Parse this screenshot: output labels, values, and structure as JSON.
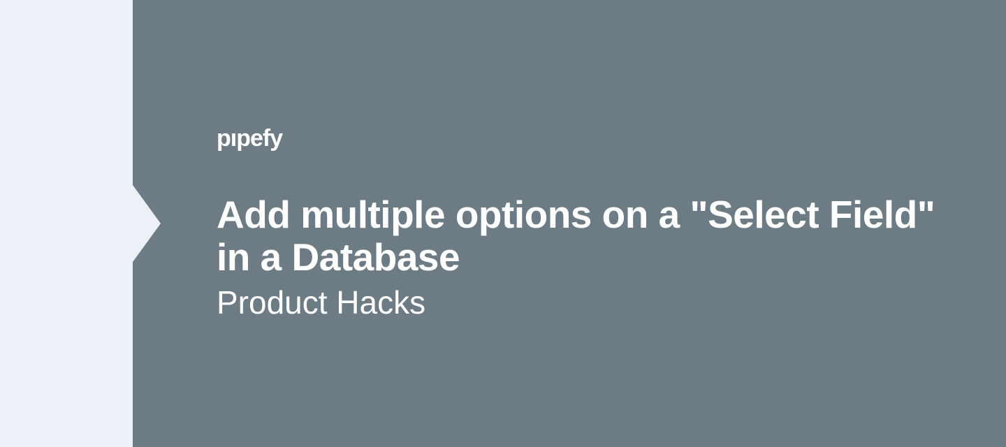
{
  "brand": {
    "name": "pipefy"
  },
  "content": {
    "title": "Add multiple options on a \"Select Field\" in a Database",
    "subtitle": "Product Hacks"
  }
}
